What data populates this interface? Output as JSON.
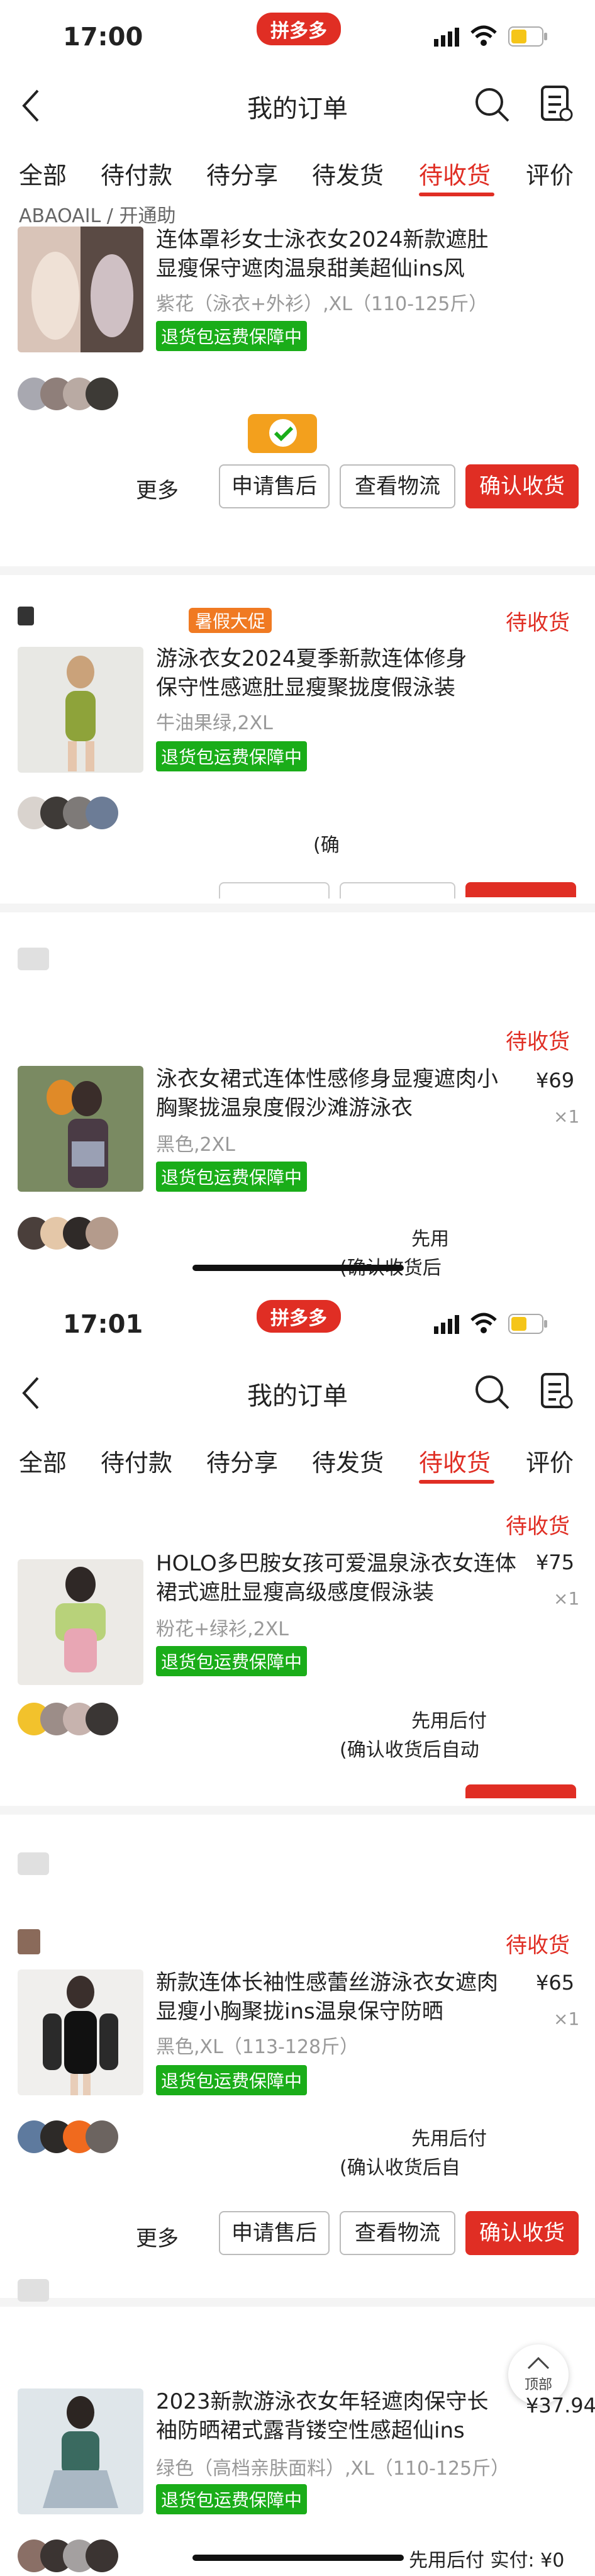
{
  "screen1": {
    "time": "17:00",
    "brand": "拼多多",
    "nav_title": "我的订单",
    "tabs": [
      "全部",
      "待付款",
      "待分享",
      "待发货",
      "待收货",
      "评价"
    ],
    "active_tab": "待收货",
    "orders": [
      {
        "store_partial": "ABAOAIL / 开通助",
        "title": "连体罩衫女士泳衣女2024新款遮肚显瘦保守遮肉温泉甜美超仙ins风",
        "spec": "紫花（泳衣+外衫）,XL（110-125斤）",
        "guarantee": "退货包运费保障中",
        "buttons": [
          "更多",
          "申请售后",
          "查看物流",
          "确认收货"
        ]
      },
      {
        "store_partial": "暑假大促",
        "status": "待收货",
        "title": "游泳衣女2024夏季新款连体修身保守性感遮肚显瘦聚拢度假泳装",
        "spec": "牛油果绿,2XL",
        "guarantee": "退货包运费保障中",
        "note": "(确"
      },
      {
        "status": "待收货",
        "title": "泳衣女裙式连体性感修身显瘦遮肉小胸聚拢温泉度假沙滩游泳衣",
        "spec": "黑色,2XL",
        "guarantee": "退货包运费保障中",
        "price": "¥69",
        "qty": "×1",
        "note1": "先用",
        "note2": "(确认收货后"
      }
    ]
  },
  "screen2": {
    "time": "17:01",
    "brand": "拼多多",
    "nav_title": "我的订单",
    "tabs": [
      "全部",
      "待付款",
      "待分享",
      "待发货",
      "待收货",
      "评价"
    ],
    "active_tab": "待收货",
    "orders": [
      {
        "status": "待收货",
        "title": "HOLO多巴胺女孩可爱温泉泳衣女连体裙式遮肚显瘦高级感度假泳装",
        "spec": "粉花+绿衫,2XL",
        "guarantee": "退货包运费保障中",
        "price": "¥75",
        "qty": "×1",
        "note1": "先用后付",
        "note2": "(确认收货后自动"
      },
      {
        "status": "待收货",
        "title": "新款连体长袖性感蕾丝游泳衣女遮肉显瘦小胸聚拢ins温泉保守防晒",
        "spec": "黑色,XL（113-128斤）",
        "guarantee": "退货包运费保障中",
        "price": "¥65",
        "qty": "×1",
        "note1": "先用后付",
        "note2": "(确认收货后自",
        "buttons": [
          "更多",
          "申请售后",
          "查看物流",
          "确认收货"
        ]
      },
      {
        "title": "2023新款游泳衣女年轻遮肉保守长袖防晒裙式露背镂空性感超仙ins",
        "spec": "绿色（高档亲肤面料）,XL（110-125斤）",
        "guarantee": "退货包运费保障中",
        "price": "¥37.94",
        "top_button": "顶部",
        "footer": "先用后付 实付: ¥0"
      }
    ]
  }
}
